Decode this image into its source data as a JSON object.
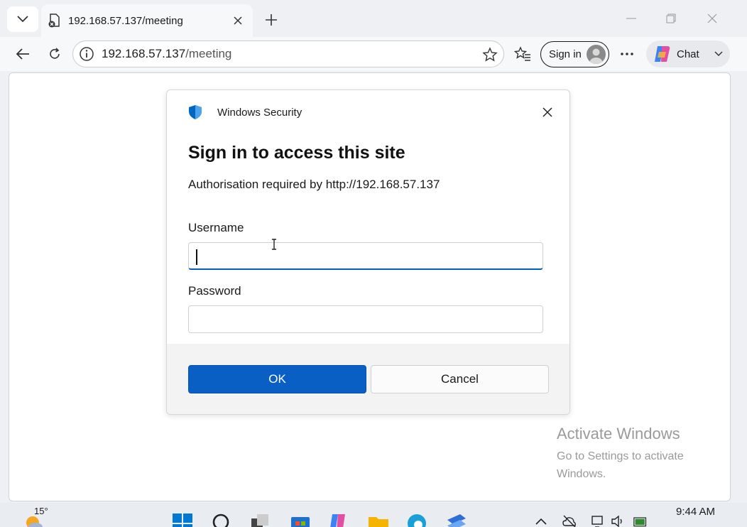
{
  "tab": {
    "title": "192.168.57.137/meeting"
  },
  "address": {
    "host": "192.168.57.137",
    "path": "/meeting"
  },
  "toolbar": {
    "signin_label": "Sign in",
    "chat_label": "Chat"
  },
  "dialog": {
    "app_name": "Windows Security",
    "title": "Sign in to access this site",
    "subtitle": "Authorisation required by http://192.168.57.137",
    "username_label": "Username",
    "username_value": "",
    "password_label": "Password",
    "password_value": "",
    "ok_label": "OK",
    "cancel_label": "Cancel"
  },
  "watermark": {
    "title": "Activate Windows",
    "subtitle": "Go to Settings to activate Windows."
  },
  "taskbar": {
    "temperature": "15°",
    "time": "9:44 AM"
  },
  "colors": {
    "accent": "#0a5fc4",
    "shield": "#0067c0",
    "chrome_bg": "#eef0f3"
  }
}
